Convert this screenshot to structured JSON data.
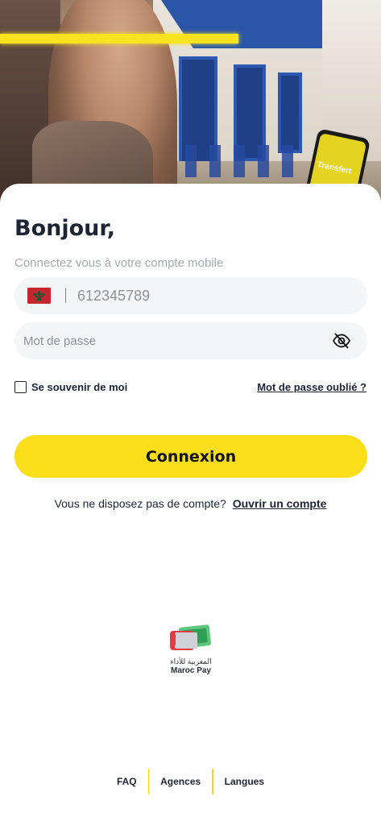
{
  "hero": {
    "phone_text": "Transfert"
  },
  "login": {
    "greeting": "Bonjour,",
    "subtitle": "Connectez vous à votre compte mobile",
    "phone_placeholder": "612345789",
    "password_placeholder": "Mot de passe",
    "remember_label": "Se souvenir de moi",
    "forgot_label": "Mot de passe oublié ?",
    "submit_label": "Connexion",
    "signup_prompt": "Vous ne disposez pas de compte?",
    "signup_link": "Ouvrir un compte"
  },
  "brand": {
    "arabic_name": "المغربية للأداء",
    "latin_name": "Maroc Pay"
  },
  "footer": {
    "links": [
      "FAQ",
      "Agences",
      "Langues"
    ]
  },
  "colors": {
    "accent": "#fbde1a",
    "text": "#1d2433",
    "field_bg": "#f4f5f6"
  },
  "icons": [
    "morocco-flag-icon",
    "eye-slash-icon",
    "checkbox-icon",
    "maroc-pay-logo"
  ]
}
